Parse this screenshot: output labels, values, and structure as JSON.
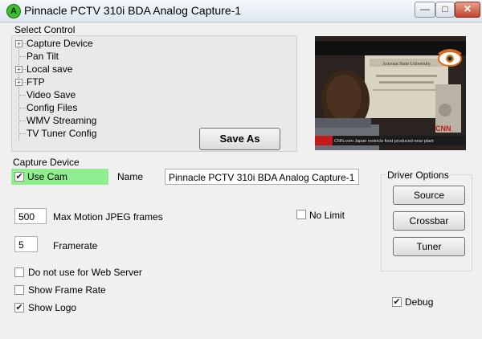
{
  "window": {
    "title": "Pinnacle PCTV 310i BDA Analog Capture-1",
    "icon_letter": "A",
    "minimize": "—",
    "maximize": "□",
    "close": "✕"
  },
  "select_control": {
    "label": "Select Control",
    "tree": [
      {
        "label": "Capture Device",
        "expander": "+"
      },
      {
        "label": "Pan Tilt",
        "expander": ""
      },
      {
        "label": "Local save",
        "expander": "+"
      },
      {
        "label": "FTP",
        "expander": "+"
      },
      {
        "label": "Video Save",
        "expander": ""
      },
      {
        "label": "Config Files",
        "expander": ""
      },
      {
        "label": "WMV Streaming",
        "expander": ""
      },
      {
        "label": "TV Tuner Config",
        "expander": ""
      }
    ],
    "save_as_label": "Save As"
  },
  "preview": {
    "banner": "Arizona State University",
    "ticker": "CNN.com  Japan restricts food produced near plant",
    "channel": "CNN"
  },
  "capture_device": {
    "label": "Capture Device",
    "use_cam_label": "Use Cam",
    "use_cam_checked": true,
    "name_label": "Name",
    "name_value": "Pinnacle PCTV 310i BDA Analog Capture-1",
    "max_motion_value": "500",
    "max_motion_label": "Max Motion JPEG frames",
    "no_limit_label": "No Limit",
    "no_limit_checked": false,
    "framerate_value": "5",
    "framerate_label": "Framerate",
    "do_not_use_label": "Do not use for Web Server",
    "do_not_use_checked": false,
    "show_frame_rate_label": "Show Frame Rate",
    "show_frame_rate_checked": false,
    "show_logo_label": "Show Logo",
    "show_logo_checked": true,
    "debug_label": "Debug",
    "debug_checked": true
  },
  "driver_options": {
    "label": "Driver Options",
    "source_label": "Source",
    "crossbar_label": "Crossbar",
    "tuner_label": "Tuner"
  },
  "colors": {
    "use_cam_highlight": "#90ee90",
    "titlebar_top": "#f6f8fb",
    "close_button": "#c2452d"
  }
}
